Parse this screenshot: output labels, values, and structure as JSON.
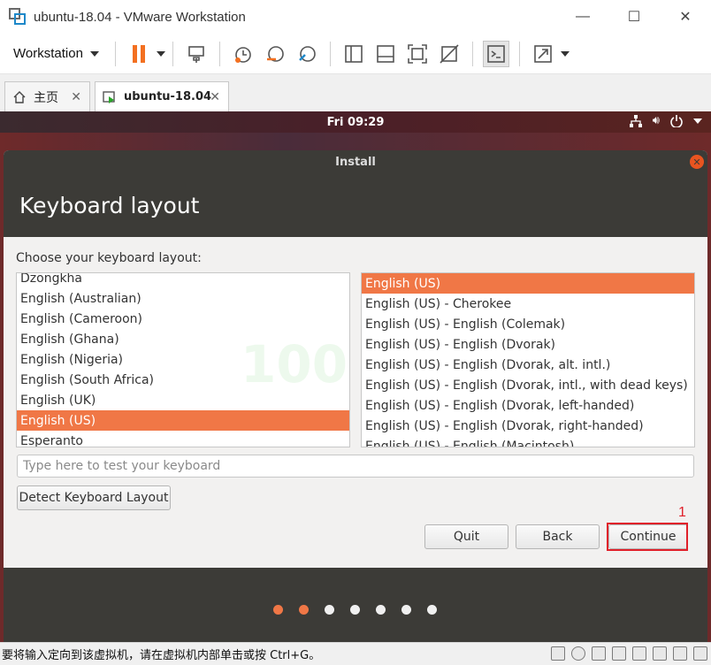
{
  "window": {
    "title": "ubuntu-18.04 - VMware Workstation",
    "minimize": "—",
    "maximize": "☐",
    "close": "✕"
  },
  "toolbar": {
    "workstation_label": "Workstation"
  },
  "tabs": [
    {
      "label": "主页"
    },
    {
      "label": "ubuntu-18.04"
    }
  ],
  "ubuntu_panel": {
    "clock": "Fri 09:29"
  },
  "installer": {
    "title": "Install",
    "header": "Keyboard layout",
    "choose_label": "Choose your keyboard layout:",
    "layouts": [
      {
        "label": "Dzongkha"
      },
      {
        "label": "English (Australian)"
      },
      {
        "label": "English (Cameroon)"
      },
      {
        "label": "English (Ghana)"
      },
      {
        "label": "English (Nigeria)"
      },
      {
        "label": "English (South Africa)"
      },
      {
        "label": "English (UK)"
      },
      {
        "label": "English (US)"
      },
      {
        "label": "Esperanto"
      }
    ],
    "variants": [
      {
        "label": "English (US)"
      },
      {
        "label": "English (US) - Cherokee"
      },
      {
        "label": "English (US) - English (Colemak)"
      },
      {
        "label": "English (US) - English (Dvorak)"
      },
      {
        "label": "English (US) - English (Dvorak, alt. intl.)"
      },
      {
        "label": "English (US) - English (Dvorak, intl., with dead keys)"
      },
      {
        "label": "English (US) - English (Dvorak, left-handed)"
      },
      {
        "label": "English (US) - English (Dvorak, right-handed)"
      },
      {
        "label": "English (US) - English (Macintosh)"
      }
    ],
    "test_placeholder": "Type here to test your keyboard",
    "detect_label": "Detect Keyboard Layout",
    "quit_label": "Quit",
    "back_label": "Back",
    "continue_label": "Continue",
    "annotation_number": "1"
  },
  "watermark": "100",
  "statusbar": {
    "text": "要将输入定向到该虚拟机，请在虚拟机内部单击或按 Ctrl+G。"
  },
  "colors": {
    "accent": "#f07746",
    "ubuntu_dark": "#3c3b37",
    "annotation": "#e0202a"
  }
}
